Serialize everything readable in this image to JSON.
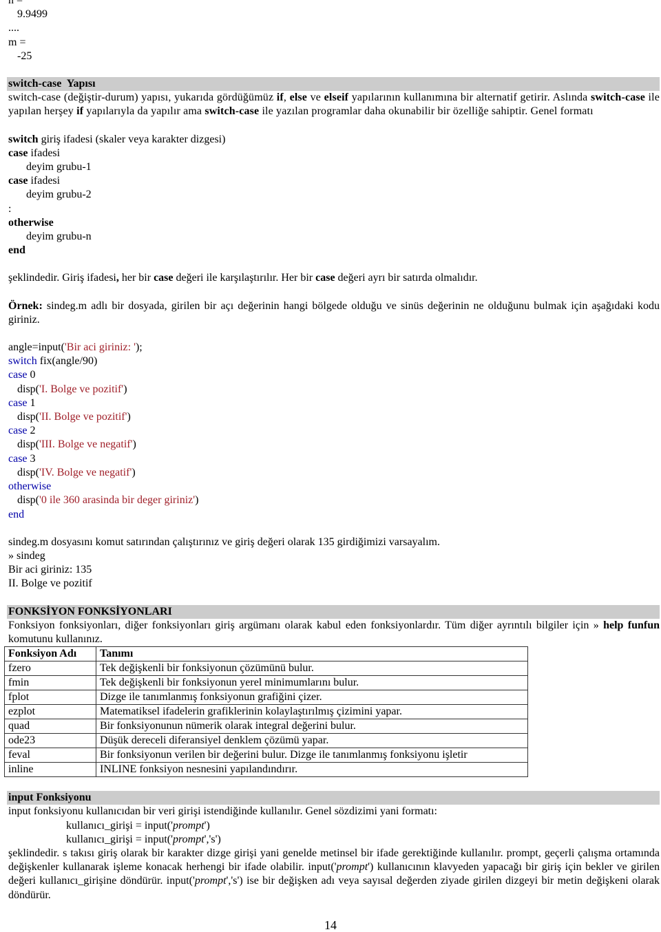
{
  "top_output": {
    "n_label": "n =",
    "n_value": "9.9499",
    "ellipsis": "....",
    "m_label": "m =",
    "m_value": "-25"
  },
  "switch_section": {
    "heading": "switch-case  Yapısı",
    "intro": {
      "p1": "switch-case (değiştir-durum) yapısı, yukarıda gördüğümüz ",
      "if": "if",
      "comma": ", ",
      "else": "else",
      "ve": " ve ",
      "elseif": "elseif",
      "p2": "  yapılarının kullanımına bir alternatif getirir. Aslında ",
      "sc1": "switch-case",
      "p3": " ile yapılan herşey ",
      "if2": "if",
      "p4": " yapılarıyla da yapılır ama ",
      "sc2": "switch-case",
      "p5": " ile yazılan programlar daha okunabilir bir özelliğe sahiptir. Genel formatı"
    },
    "format": [
      {
        "kw": "switch",
        "rest": " giriş ifadesi (skaler veya karakter dizgesi)"
      },
      {
        "kw": "case",
        "rest": " ifadesi"
      },
      {
        "kw": "",
        "rest": "deyim grubu-1",
        "indent": true
      },
      {
        "kw": "case",
        "rest": " ifadesi"
      },
      {
        "kw": "",
        "rest": "deyim grubu-2",
        "indent": true
      },
      {
        "kw": "",
        "rest": ":"
      },
      {
        "kw": "otherwise",
        "rest": ""
      },
      {
        "kw": "",
        "rest": "deyim grubu-n",
        "indent": true
      },
      {
        "kw": "end",
        "rest": ""
      }
    ],
    "after_format": {
      "p1": "şeklindedir. Giriş ifadesi",
      "comma": ",",
      "p2": " her bir ",
      "case1": "case",
      "p3": " değeri ile karşılaştırılır. Her bir ",
      "case2": "case",
      "p4": " değeri ayrı bir satırda olmalıdır."
    },
    "example": {
      "label": "Örnek:",
      "text": " sindeg.m adlı bir dosyada, girilen bir açı değerinin hangi bölgede olduğu ve sinüs değerinin ne olduğunu bulmak için aşağıdaki kodu giriniz."
    },
    "code": [
      {
        "pre": "angle=input(",
        "kw": "",
        "str": "'Bir aci giriniz: '",
        "post": ");",
        "indent": false
      },
      {
        "pre": "",
        "kw": "switch",
        "str": "",
        "post": " fix(angle/90)",
        "indent": false
      },
      {
        "pre": "",
        "kw": "case",
        "str": "",
        "post": " 0",
        "indent": false
      },
      {
        "pre": "disp(",
        "kw": "",
        "str": "'I. Bolge ve pozitif'",
        "post": ")",
        "indent": true
      },
      {
        "pre": "",
        "kw": "case",
        "str": "",
        "post": " 1",
        "indent": false
      },
      {
        "pre": "disp(",
        "kw": "",
        "str": "'II. Bolge ve pozitif'",
        "post": ")",
        "indent": true
      },
      {
        "pre": "",
        "kw": "case",
        "str": "",
        "post": " 2",
        "indent": false
      },
      {
        "pre": "disp(",
        "kw": "",
        "str": "'III. Bolge ve negatif'",
        "post": ")",
        "indent": true
      },
      {
        "pre": "",
        "kw": "case",
        "str": "",
        "post": " 3",
        "indent": false
      },
      {
        "pre": "disp(",
        "kw": "",
        "str": "'IV. Bolge ve negatif'",
        "post": ")",
        "indent": true
      },
      {
        "pre": "",
        "kw": "otherwise",
        "str": "",
        "post": "",
        "indent": false
      },
      {
        "pre": "disp(",
        "kw": "",
        "str": "'0 ile 360 arasinda bir deger giriniz'",
        "post": ")",
        "indent": true
      },
      {
        "pre": "",
        "kw": "end",
        "str": "",
        "post": "",
        "indent": false
      }
    ],
    "run_text": "sindeg.m dosyasını komut satırından çalıştırınız ve giriş değeri olarak 135 girdiğimizi varsayalım.",
    "run_output": [
      "» sindeg",
      "Bir aci giriniz: 135",
      "II. Bolge ve pozitif"
    ]
  },
  "function_section": {
    "heading": "FONKSİYON FONKSİYONLARI",
    "intro": "Fonksiyon fonksiyonları, diğer fonksiyonları giriş argümanı olarak kabul eden fonksiyonlardır. Tüm diğer ayrıntılı bilgiler için » ",
    "help_cmd": "help funfun",
    "intro_end": " komutunu kullanınız.",
    "table": {
      "headers": [
        "Fonksiyon Adı",
        "Tanımı"
      ],
      "rows": [
        [
          "fzero",
          "Tek değişkenli bir fonksiyonun çözümünü bulur."
        ],
        [
          "fmin",
          "Tek değişkenli bir fonksiyonun yerel minimumlarını bulur."
        ],
        [
          "fplot",
          "Dizge ile tanımlanmış fonksiyonun grafiğini çizer."
        ],
        [
          "ezplot",
          "Matematiksel ifadelerin grafiklerinin kolaylaştırılmış çizimini yapar."
        ],
        [
          "quad",
          "Bir fonksiyonunun nümerik olarak integral değerini bulur."
        ],
        [
          "ode23",
          "Düşük dereceli diferansiyel denklem çözümü yapar."
        ],
        [
          "feval",
          "Bir fonksiyonun verilen bir değerini bulur. Dizge ile tanımlanmış fonksiyonu işletir"
        ],
        [
          "inline",
          "INLINE fonksiyon nesnesini yapılandındırır."
        ]
      ]
    }
  },
  "input_section": {
    "heading_plain": "input ",
    "heading_bold": "Fonksiyonu",
    "intro": "input fonksiyonu kullanıcıdan bir veri girişi istendiğinde kullanılır. Genel sözdizimi yani formatı:",
    "syntax": [
      {
        "pre": "kullanıcı_girişi = input('",
        "it": "prompt",
        "post": "')"
      },
      {
        "pre": "kullanıcı_girişi = input('",
        "it": "prompt",
        "post": "','s')"
      }
    ],
    "desc": {
      "p1": "şeklindedir. s takısı giriş olarak bir karakter dizge girişi yani genelde metinsel bir ifade gerektiğinde kullanılır. prompt, geçerli çalışma ortamında değişkenler kullanarak işleme konacak herhengi bir ifade olabilir. input('",
      "it1": "prompt",
      "p2": "') kullanıcının klavyeden yapacağı bir giriş için bekler ve girilen değeri kullanıcı_girişine döndürür. input('",
      "it2": "prompt",
      "p3": "','s') ise bir değişken adı veya sayısal değerden ziyade girilen dizgeyi bir metin değişkeni olarak döndürür."
    }
  },
  "page_number": "14"
}
